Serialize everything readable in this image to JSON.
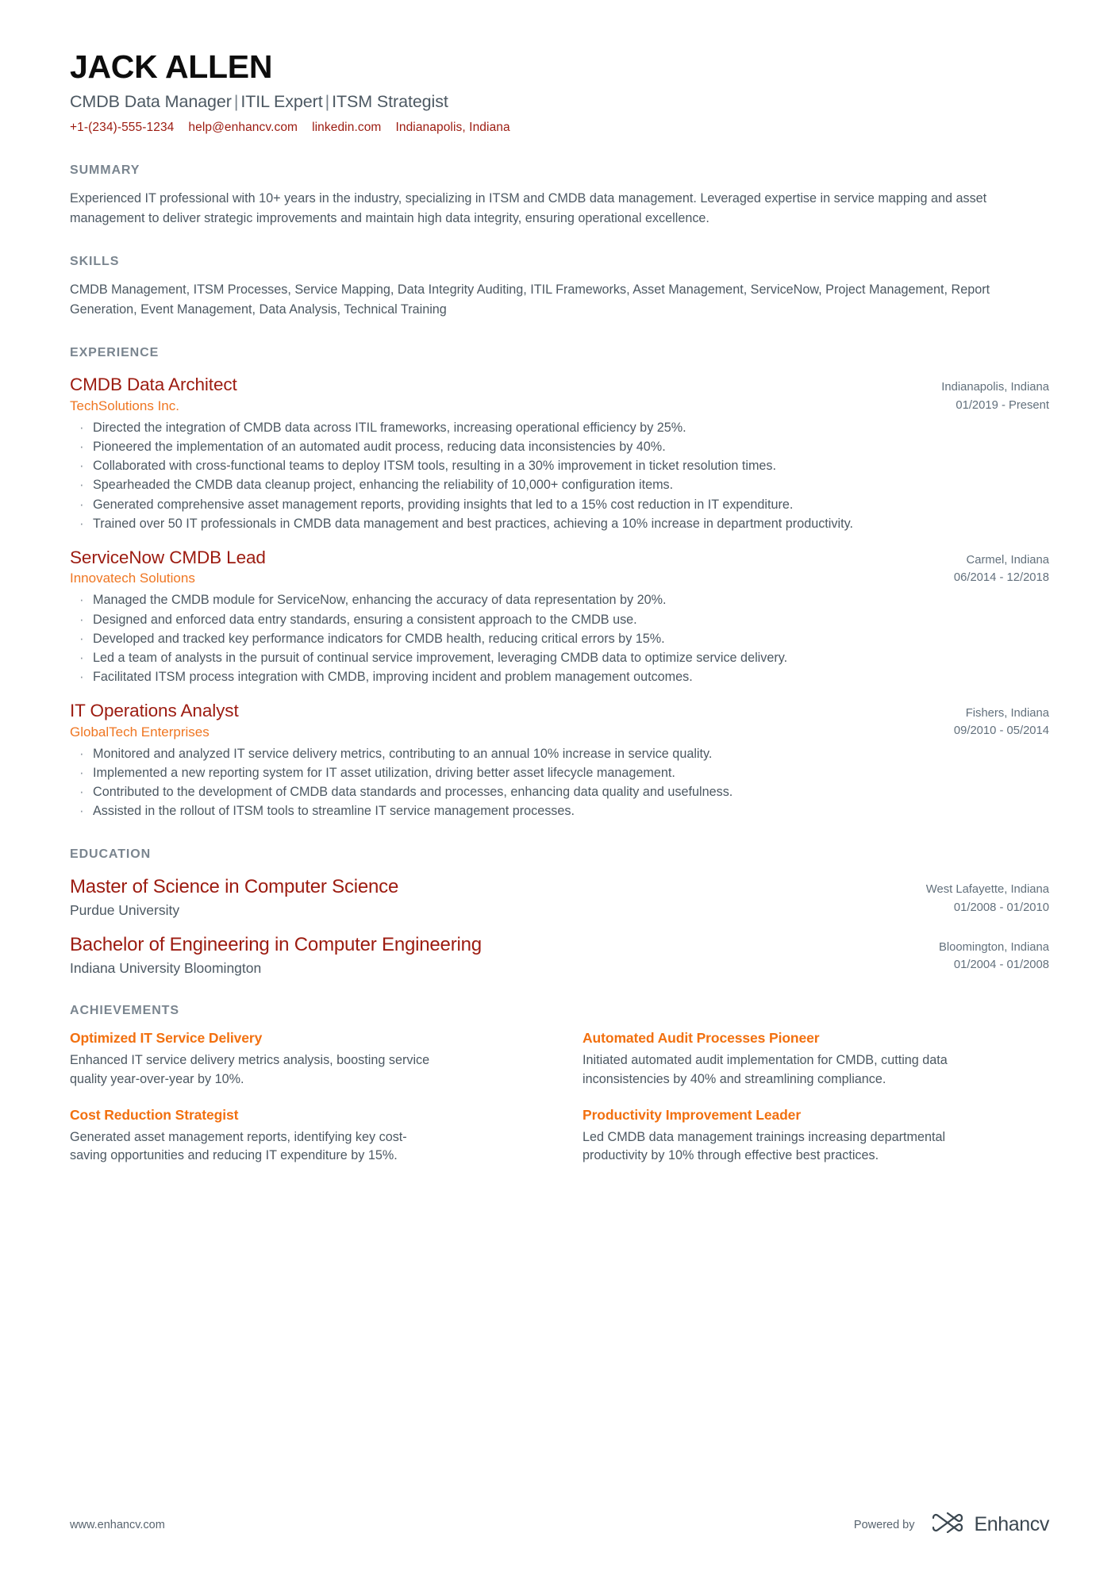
{
  "header": {
    "name": "JACK ALLEN",
    "subtitle_parts": [
      "CMDB Data Manager",
      "ITIL Expert",
      "ITSM Strategist"
    ],
    "separator": "|",
    "contacts": [
      {
        "name": "phone",
        "text": "+1-(234)-555-1234"
      },
      {
        "name": "email",
        "text": "help@enhancv.com"
      },
      {
        "name": "linkedin",
        "text": "linkedin.com"
      },
      {
        "name": "location",
        "text": "Indianapolis, Indiana"
      }
    ]
  },
  "summary": {
    "title": "SUMMARY",
    "text": "Experienced IT professional with 10+ years in the industry, specializing in ITSM and CMDB data management. Leveraged expertise in service mapping and asset management to deliver strategic improvements and maintain high data integrity, ensuring operational excellence."
  },
  "skills": {
    "title": "SKILLS",
    "text": "CMDB Management, ITSM Processes, Service Mapping, Data Integrity Auditing, ITIL Frameworks, Asset Management, ServiceNow, Project Management, Report Generation, Event Management, Data Analysis, Technical Training"
  },
  "experience": {
    "title": "EXPERIENCE",
    "entries": [
      {
        "title": "CMDB Data Architect",
        "org": "TechSolutions Inc.",
        "location": "Indianapolis, Indiana",
        "date": "01/2019 - Present",
        "bullets": [
          "Directed the integration of CMDB data across ITIL frameworks, increasing operational efficiency by 25%.",
          "Pioneered the implementation of an automated audit process, reducing data inconsistencies by 40%.",
          "Collaborated with cross-functional teams to deploy ITSM tools, resulting in a 30% improvement in ticket resolution times.",
          "Spearheaded the CMDB data cleanup project, enhancing the reliability of 10,000+ configuration items.",
          "Generated comprehensive asset management reports, providing insights that led to a 15% cost reduction in IT expenditure.",
          "Trained over 50 IT professionals in CMDB data management and best practices, achieving a 10% increase in department productivity."
        ]
      },
      {
        "title": "ServiceNow CMDB Lead",
        "org": "Innovatech Solutions",
        "location": "Carmel, Indiana",
        "date": "06/2014 - 12/2018",
        "bullets": [
          "Managed the CMDB module for ServiceNow, enhancing the accuracy of data representation by 20%.",
          "Designed and enforced data entry standards, ensuring a consistent approach to the CMDB use.",
          "Developed and tracked key performance indicators for CMDB health, reducing critical errors by 15%.",
          "Led a team of analysts in the pursuit of continual service improvement, leveraging CMDB data to optimize service delivery.",
          "Facilitated ITSM process integration with CMDB, improving incident and problem management outcomes."
        ]
      },
      {
        "title": "IT Operations Analyst",
        "org": "GlobalTech Enterprises",
        "location": "Fishers, Indiana",
        "date": "09/2010 - 05/2014",
        "bullets": [
          "Monitored and analyzed IT service delivery metrics, contributing to an annual 10% increase in service quality.",
          "Implemented a new reporting system for IT asset utilization, driving better asset lifecycle management.",
          "Contributed to the development of CMDB data standards and processes, enhancing data quality and usefulness.",
          "Assisted in the rollout of ITSM tools to streamline IT service management processes."
        ]
      }
    ]
  },
  "education": {
    "title": "EDUCATION",
    "entries": [
      {
        "title": "Master of Science in Computer Science",
        "org": "Purdue University",
        "location": "West Lafayette, Indiana",
        "date": "01/2008 - 01/2010"
      },
      {
        "title": "Bachelor of Engineering in Computer Engineering",
        "org": "Indiana University Bloomington",
        "location": "Bloomington, Indiana",
        "date": "01/2004 - 01/2008"
      }
    ]
  },
  "achievements": {
    "title": "ACHIEVEMENTS",
    "items": [
      {
        "title": "Optimized IT Service Delivery",
        "desc": "Enhanced IT service delivery metrics analysis, boosting service quality year-over-year by 10%."
      },
      {
        "title": "Automated Audit Processes Pioneer",
        "desc": "Initiated automated audit implementation for CMDB, cutting data inconsistencies by 40% and streamlining compliance."
      },
      {
        "title": "Cost Reduction Strategist",
        "desc": "Generated asset management reports, identifying key cost-saving opportunities and reducing IT expenditure by 15%."
      },
      {
        "title": "Productivity Improvement Leader",
        "desc": "Led CMDB data management trainings increasing departmental productivity by 10% through effective best practices."
      }
    ]
  },
  "footer": {
    "url": "www.enhancv.com",
    "powered_by": "Powered by",
    "brand_name": "Enhancv"
  },
  "colors": {
    "accent_red": "#9c1b10",
    "accent_orange": "#ef7622",
    "heading_gray": "#7a858f",
    "body_gray": "#4c5862"
  }
}
